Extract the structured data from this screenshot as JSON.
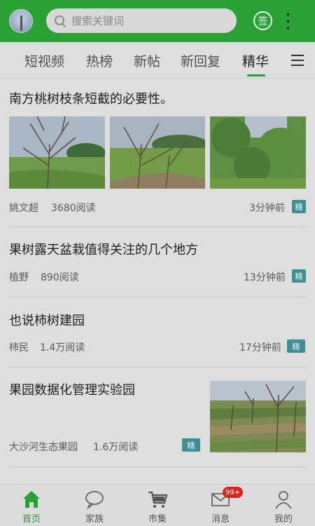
{
  "header": {
    "search_placeholder": "搜索关键词",
    "sign_label": "签"
  },
  "tabs": [
    {
      "label": "短视频"
    },
    {
      "label": "热榜"
    },
    {
      "label": "新帖"
    },
    {
      "label": "新回复"
    },
    {
      "label": "精华"
    }
  ],
  "articles": [
    {
      "title": "南方桃树枝条短截的必要性。",
      "author": "姚文超",
      "reads": "3680阅读",
      "time": "3分钟前",
      "badge": "精"
    },
    {
      "title": "果树露天盆栽值得关注的几个地方",
      "author": "植野",
      "reads": "890阅读",
      "time": "13分钟前",
      "badge": "精"
    },
    {
      "title": "也说柿树建园",
      "author": "柿民",
      "reads": "1.4万阅读",
      "time": "17分钟前",
      "badge": "精"
    },
    {
      "title": "果园数据化管理实验园",
      "author": "大沙河生态果园",
      "reads": "1.6万阅读",
      "time": "",
      "badge": "精"
    }
  ],
  "bottom_nav": [
    {
      "label": "首页"
    },
    {
      "label": "家族"
    },
    {
      "label": "市集"
    },
    {
      "label": "消息"
    },
    {
      "label": "我的"
    }
  ],
  "message_badge": "99+",
  "colors": {
    "brand_green": "#2aa134",
    "badge_teal": "#3e8f94",
    "alert_red": "#d9231f"
  }
}
